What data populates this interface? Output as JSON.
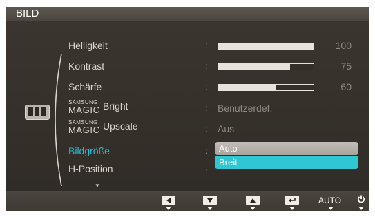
{
  "menu": {
    "title": "BILD",
    "category_icon": "picture-category-icon"
  },
  "items": [
    {
      "id": "helligkeit",
      "label": "Helligkeit",
      "type": "slider",
      "value": 100
    },
    {
      "id": "kontrast",
      "label": "Kontrast",
      "type": "slider",
      "value": 75
    },
    {
      "id": "schaerfe",
      "label": "Schärfe",
      "type": "slider",
      "value": 60
    },
    {
      "id": "magic-bright",
      "brand_small": "SAMSUNG",
      "brand_large": "MAGIC",
      "label": "Bright",
      "type": "text",
      "value": "Benutzerdef."
    },
    {
      "id": "magic-upscale",
      "brand_small": "SAMSUNG",
      "brand_large": "MAGIC",
      "label": "Upscale",
      "type": "text",
      "value": "Aus"
    },
    {
      "id": "bildgroesse",
      "label": "Bildgröße",
      "type": "dropdown"
    },
    {
      "id": "h-position",
      "label": "H-Position",
      "type": "text"
    }
  ],
  "dropdown": {
    "options": [
      "Auto",
      "Breit"
    ],
    "selected": "Breit"
  },
  "separator": ":",
  "buttons": [
    {
      "id": "left",
      "icon": "left-arrow-icon"
    },
    {
      "id": "down",
      "icon": "down-arrow-icon"
    },
    {
      "id": "up",
      "icon": "up-arrow-icon"
    },
    {
      "id": "enter",
      "icon": "enter-icon"
    },
    {
      "id": "auto",
      "label": "AUTO"
    },
    {
      "id": "power",
      "icon": "power-icon"
    }
  ],
  "colors": {
    "accent": "#22bfd6",
    "selected_option": "#2fc7d4",
    "osd_background": "#36322c"
  }
}
